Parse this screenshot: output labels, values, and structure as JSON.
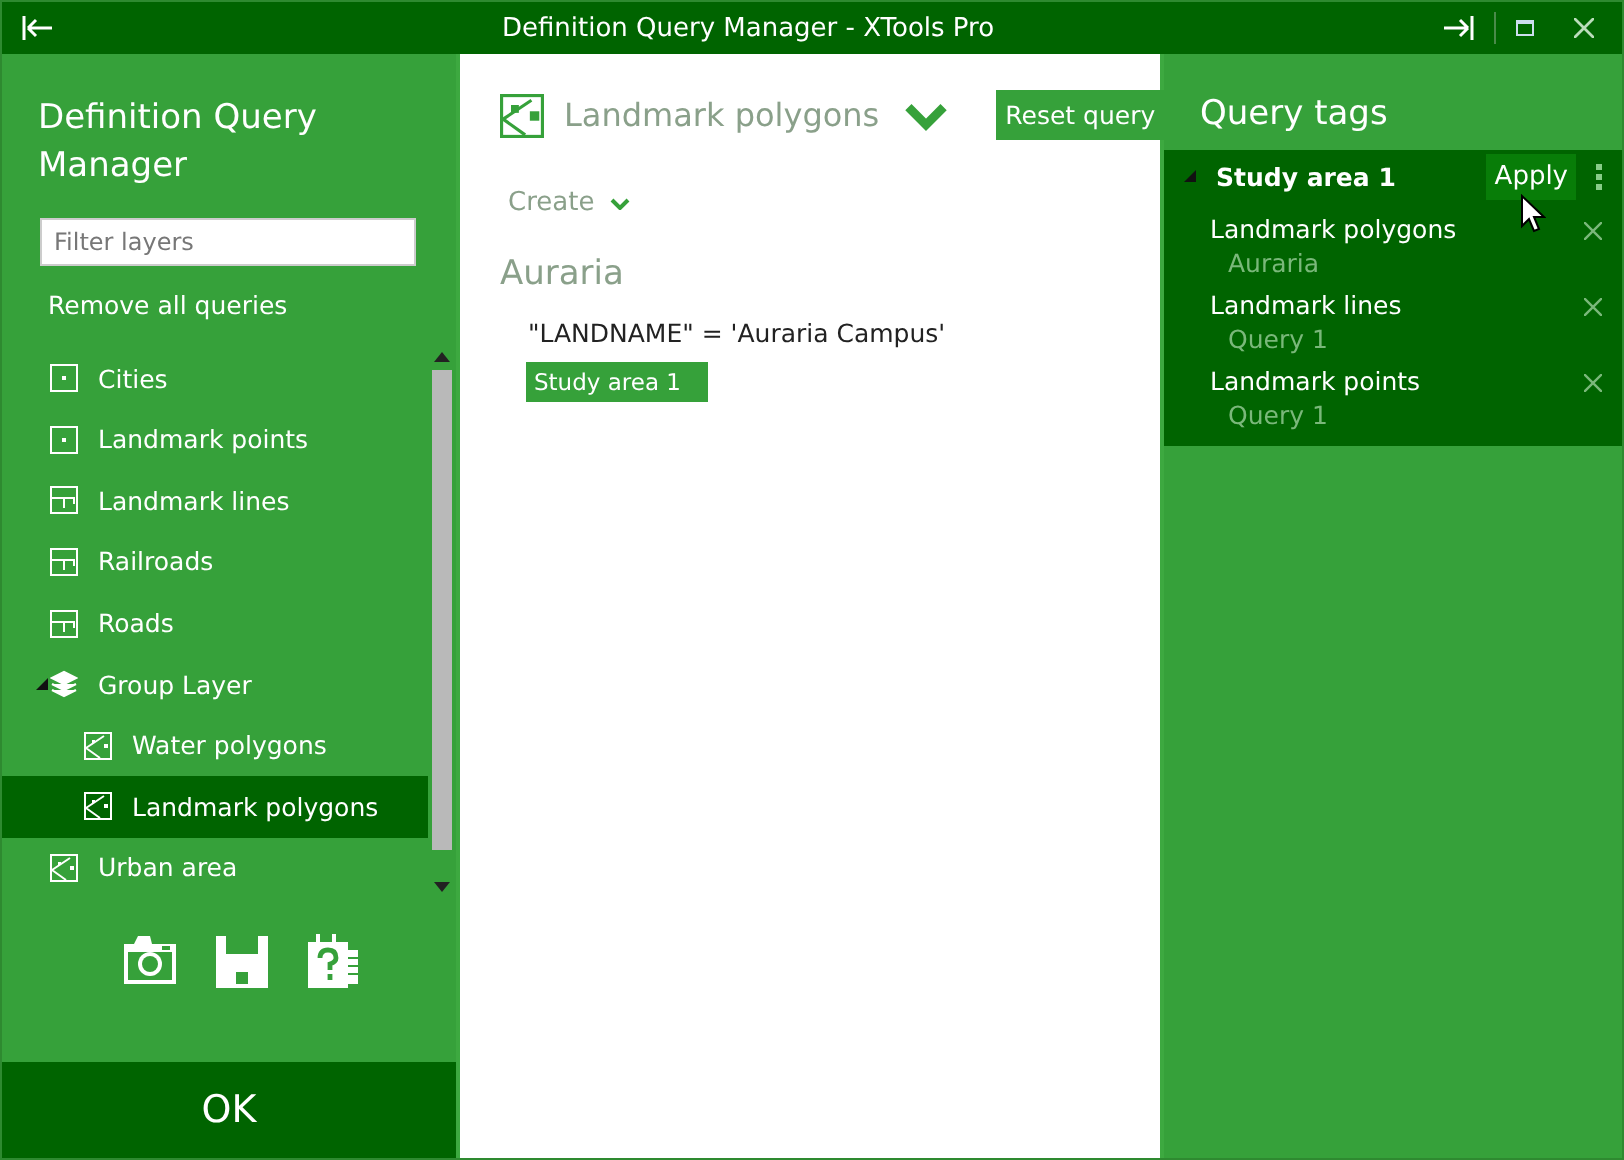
{
  "window": {
    "title": "Definition Query Manager - XTools Pro"
  },
  "sidebar": {
    "title": "Definition Query Manager",
    "filter": {
      "placeholder": "Filter layers"
    },
    "remove_all": "Remove all queries",
    "layers": [
      {
        "name": "Cities",
        "kind": "point",
        "selected": false
      },
      {
        "name": "Landmark points",
        "kind": "point",
        "selected": false
      },
      {
        "name": "Landmark lines",
        "kind": "line",
        "selected": false
      },
      {
        "name": "Railroads",
        "kind": "line",
        "selected": false
      },
      {
        "name": "Roads",
        "kind": "line",
        "selected": false
      },
      {
        "name": "Group Layer",
        "kind": "group",
        "selected": false,
        "expanded": true,
        "children": [
          {
            "name": "Water polygons",
            "kind": "polygon",
            "selected": false
          },
          {
            "name": "Landmark polygons",
            "kind": "polygon",
            "selected": true
          }
        ]
      },
      {
        "name": "Urban area",
        "kind": "polygon",
        "selected": false
      }
    ],
    "ok": "OK"
  },
  "main": {
    "layer": "Landmark polygons",
    "reset": "Reset query",
    "create": "Create",
    "queries": [
      {
        "name": "Auraria",
        "expression": "\"LANDNAME\" = 'Auraria Campus'",
        "tag": "Study area 1"
      }
    ]
  },
  "tags": {
    "title": "Query tags",
    "groups": [
      {
        "name": "Study area 1",
        "expanded": true,
        "apply": "Apply",
        "items": [
          {
            "layer": "Landmark polygons",
            "query": "Auraria"
          },
          {
            "layer": "Landmark lines",
            "query": "Query 1"
          },
          {
            "layer": "Landmark points",
            "query": "Query 1"
          }
        ]
      }
    ]
  }
}
